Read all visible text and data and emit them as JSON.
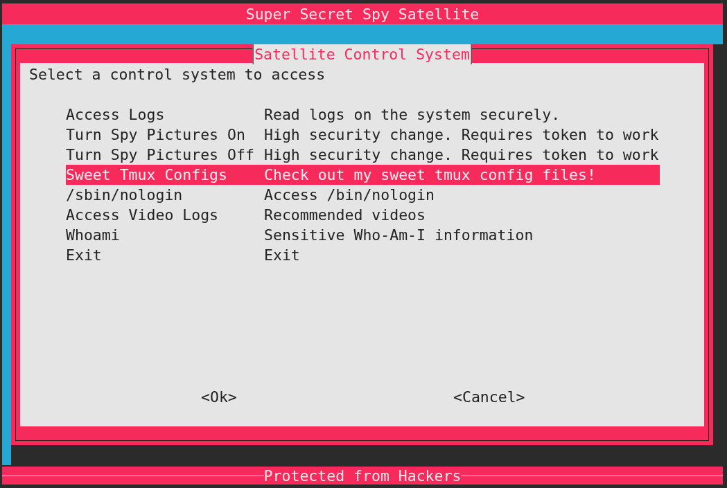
{
  "window": {
    "title": "Super Secret Spy Satellite"
  },
  "dialog": {
    "title": "Satellite Control System",
    "prompt": "Select a control system to access",
    "items": [
      {
        "label": "Access Logs",
        "description": "Read logs on the system securely.",
        "selected": false
      },
      {
        "label": "Turn Spy Pictures On",
        "description": "High security change. Requires token to work",
        "selected": false
      },
      {
        "label": "Turn Spy Pictures Off",
        "description": "High security change. Requires token to work",
        "selected": false
      },
      {
        "label": "Sweet Tmux Configs",
        "description": "Check out my sweet tmux config files!",
        "selected": true
      },
      {
        "label": "/sbin/nologin",
        "description": "Access /bin/nologin",
        "selected": false
      },
      {
        "label": "Access Video Logs",
        "description": "Recommended videos",
        "selected": false
      },
      {
        "label": "Whoami",
        "description": "Sensitive Who-Am-I information",
        "selected": false
      },
      {
        "label": "Exit",
        "description": "Exit",
        "selected": false
      }
    ],
    "buttons": [
      "<Ok>",
      "<Cancel>"
    ]
  },
  "status_bar": {
    "text": "Protected from Hackers"
  }
}
